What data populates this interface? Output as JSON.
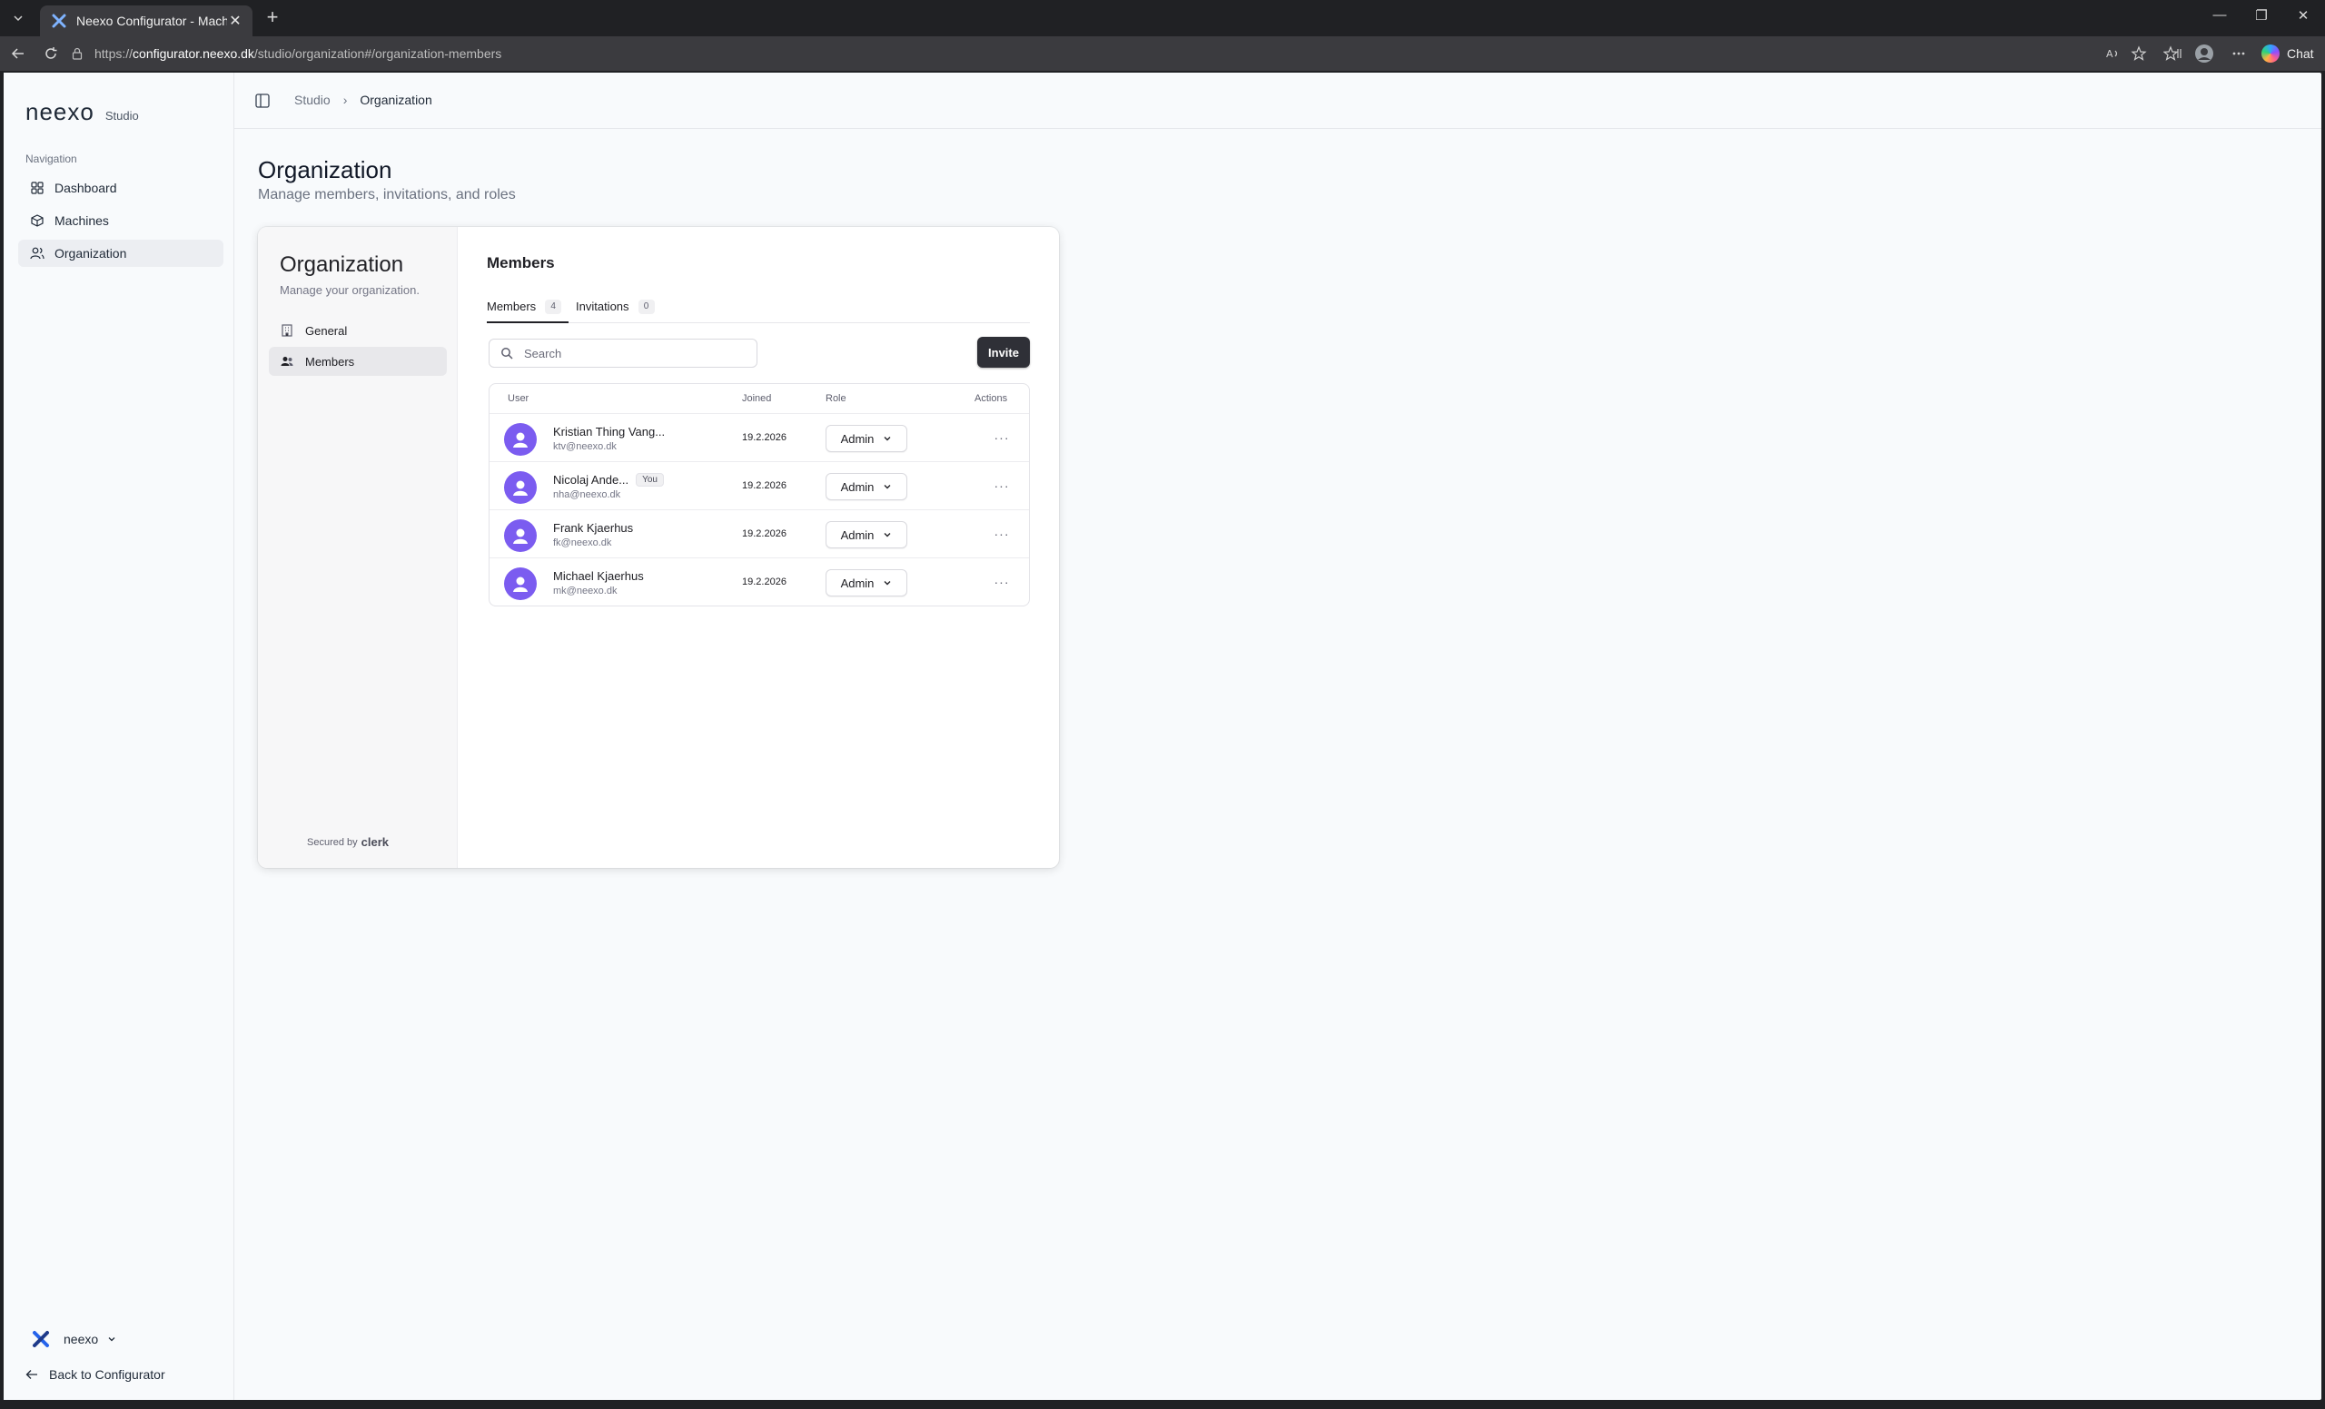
{
  "browser": {
    "tab_title": "Neexo Configurator - Machine Co",
    "url_prefix": "https://",
    "url_host": "configurator.neexo.dk",
    "url_path": "/studio/organization#/organization-members",
    "chat_label": "Chat"
  },
  "sidebar": {
    "brand": "neexo",
    "brand_sub": "Studio",
    "nav_heading": "Navigation",
    "items": [
      {
        "label": "Dashboard",
        "icon": "grid-icon"
      },
      {
        "label": "Machines",
        "icon": "cube-icon"
      },
      {
        "label": "Organization",
        "icon": "users-icon",
        "active": true
      }
    ],
    "org_name": "neexo",
    "back_label": "Back to Configurator"
  },
  "breadcrumb": {
    "root": "Studio",
    "current": "Organization"
  },
  "page": {
    "title": "Organization",
    "subtitle": "Manage members, invitations, and roles"
  },
  "org_panel": {
    "title": "Organization",
    "subtitle": "Manage your organization.",
    "nav": [
      {
        "label": "General",
        "icon": "building-icon"
      },
      {
        "label": "Members",
        "icon": "users-icon",
        "active": true
      }
    ],
    "secured_by": "Secured by",
    "secured_brand": "clerk"
  },
  "members": {
    "title": "Members",
    "tabs": [
      {
        "label": "Members",
        "count": "4",
        "active": true
      },
      {
        "label": "Invitations",
        "count": "0"
      }
    ],
    "search_placeholder": "Search",
    "invite_label": "Invite",
    "columns": {
      "user": "User",
      "joined": "Joined",
      "role": "Role",
      "actions": "Actions"
    },
    "rows": [
      {
        "name": "Kristian Thing Vang...",
        "email": "ktv@neexo.dk",
        "joined": "19.2.2026",
        "role": "Admin",
        "you": ""
      },
      {
        "name": "Nicolaj Ande...",
        "email": "nha@neexo.dk",
        "joined": "19.2.2026",
        "role": "Admin",
        "you": "You"
      },
      {
        "name": "Frank Kjaerhus",
        "email": "fk@neexo.dk",
        "joined": "19.2.2026",
        "role": "Admin",
        "you": ""
      },
      {
        "name": "Michael Kjaerhus",
        "email": "mk@neexo.dk",
        "joined": "19.2.2026",
        "role": "Admin",
        "you": ""
      }
    ]
  },
  "colors": {
    "accent": "#2f3037",
    "avatar": "#7b5cf0",
    "page_bg": "#f8fafc"
  }
}
